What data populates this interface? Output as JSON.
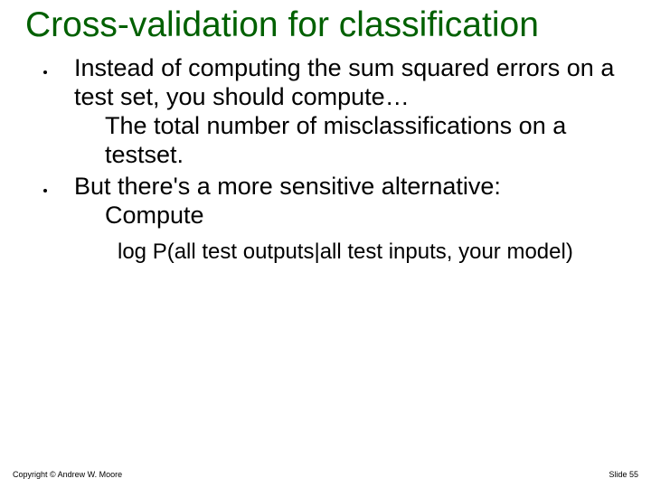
{
  "title": "Cross-validation for classification",
  "bullets": [
    {
      "main": "Instead of computing the sum squared errors on a test set, you should compute…",
      "sub": "The total number of misclassifications on a testset."
    },
    {
      "main": "But there's a more sensitive alternative:",
      "sub": "Compute"
    }
  ],
  "formula": "log P(all test outputs|all test inputs, your model)",
  "footer": {
    "copyright": "Copyright © Andrew W. Moore",
    "slide": "Slide 55"
  }
}
